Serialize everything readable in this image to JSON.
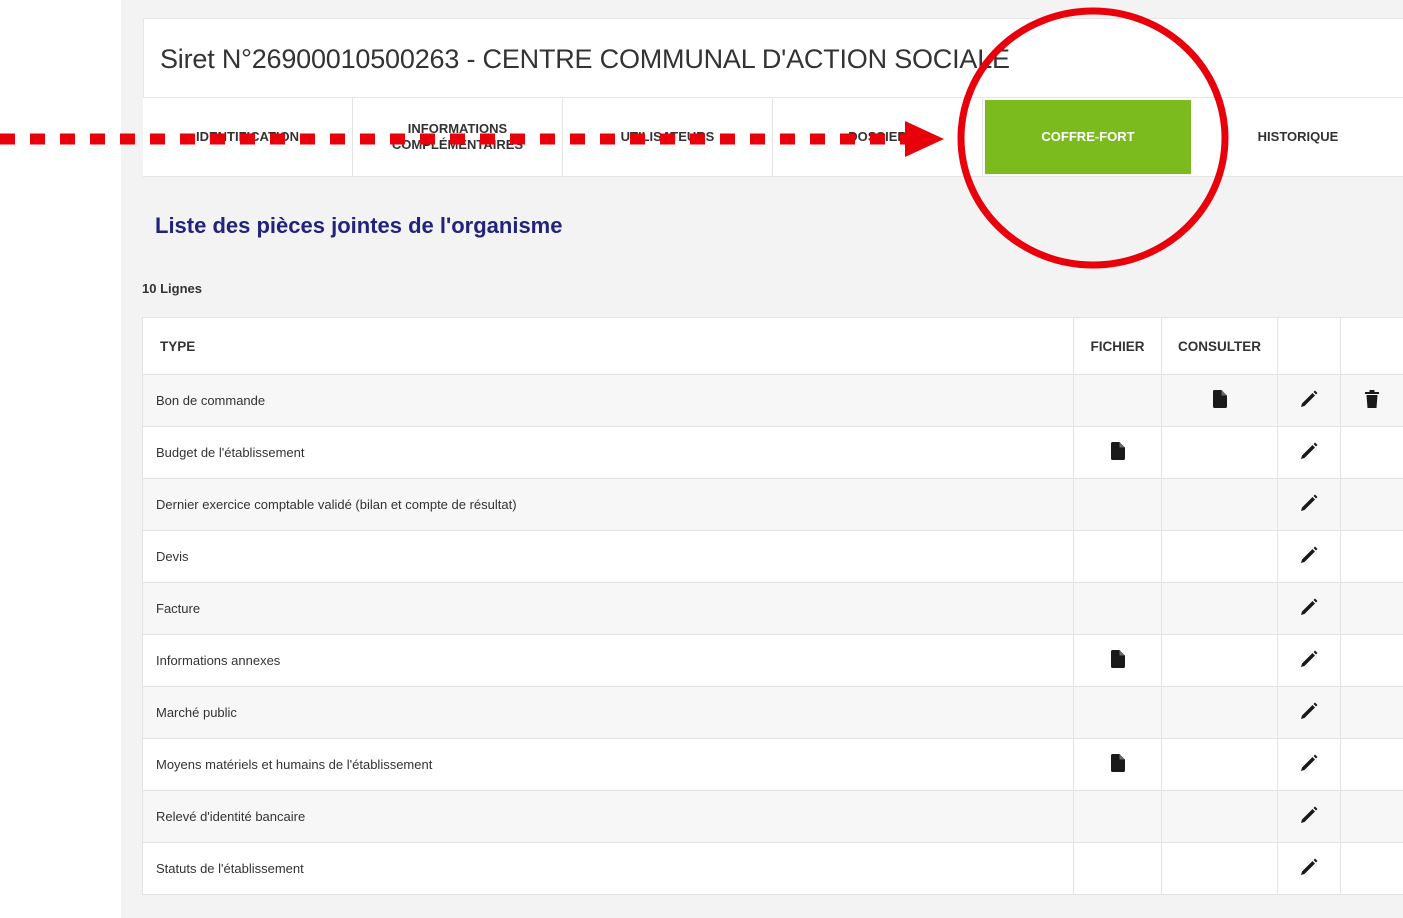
{
  "header": {
    "siret": "Siret N°26900010500263 - CENTRE COMMUNAL D'ACTION SOCIALE"
  },
  "tabs": [
    {
      "label": "IDENTIFICATION",
      "active": false
    },
    {
      "label": "INFORMATIONS COMPLÉMENTAIRES",
      "active": false
    },
    {
      "label": "UTILISATEURS",
      "active": false
    },
    {
      "label": "DOSSIER",
      "active": false
    },
    {
      "label": "COFFRE-FORT",
      "active": true
    },
    {
      "label": "HISTORIQUE",
      "active": false
    }
  ],
  "section_title": "Liste des pièces jointes de l'organisme",
  "row_count": "10 Lignes",
  "table": {
    "headers": [
      "TYPE",
      "FICHIER",
      "CONSULTER",
      "",
      ""
    ],
    "rows": [
      {
        "type": "Bon de commande",
        "fichier": false,
        "consulter": true,
        "edit": true,
        "delete": true
      },
      {
        "type": "Budget de l'établissement",
        "fichier": true,
        "consulter": false,
        "edit": true,
        "delete": false
      },
      {
        "type": "Dernier exercice comptable validé (bilan et compte de résultat)",
        "fichier": false,
        "consulter": false,
        "edit": true,
        "delete": false
      },
      {
        "type": "Devis",
        "fichier": false,
        "consulter": false,
        "edit": true,
        "delete": false
      },
      {
        "type": "Facture",
        "fichier": false,
        "consulter": false,
        "edit": true,
        "delete": false
      },
      {
        "type": "Informations annexes",
        "fichier": true,
        "consulter": false,
        "edit": true,
        "delete": false
      },
      {
        "type": "Marché public",
        "fichier": false,
        "consulter": false,
        "edit": true,
        "delete": false
      },
      {
        "type": "Moyens matériels et humains de l'établissement",
        "fichier": true,
        "consulter": false,
        "edit": true,
        "delete": false
      },
      {
        "type": "Relevé d'identité bancaire",
        "fichier": false,
        "consulter": false,
        "edit": true,
        "delete": false
      },
      {
        "type": "Statuts de l'établissement",
        "fichier": false,
        "consulter": false,
        "edit": true,
        "delete": false
      }
    ]
  },
  "annotation": {
    "arrow_color": "#e8000b",
    "circle_color": "#e8000b"
  },
  "colors": {
    "active_tab": "#7cbb1e",
    "title": "#22237a"
  }
}
